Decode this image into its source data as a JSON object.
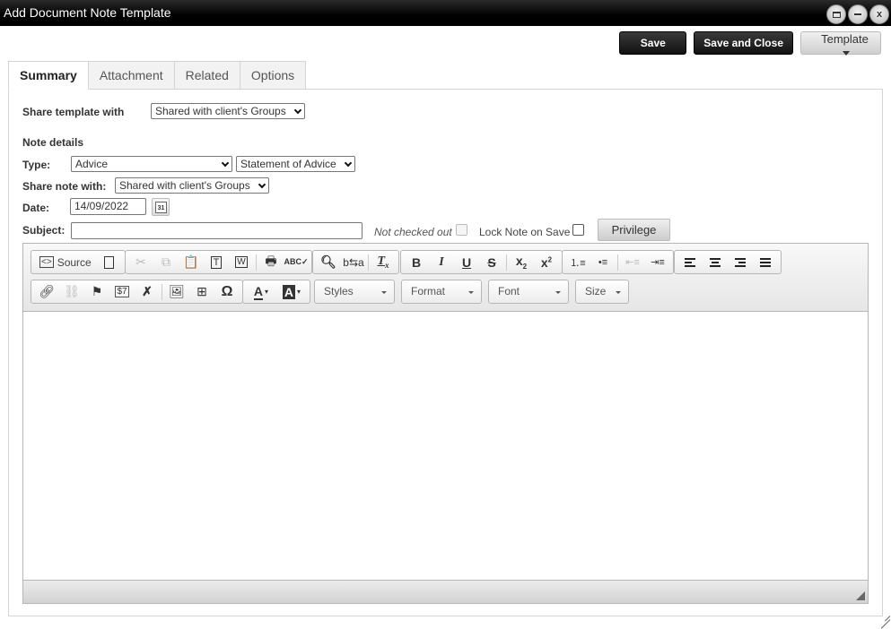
{
  "window": {
    "title": "Add Document Note Template",
    "controls": [
      "maximize",
      "minimize",
      "close"
    ],
    "close_label": "x"
  },
  "actions": {
    "save": "Save",
    "save_and_close": "Save and Close",
    "template": "Template"
  },
  "tabs": [
    {
      "label": "Summary",
      "active": true
    },
    {
      "label": "Attachment",
      "active": false
    },
    {
      "label": "Related",
      "active": false
    },
    {
      "label": "Options",
      "active": false
    }
  ],
  "form": {
    "share_template_label": "Share template with",
    "share_template_value": "Shared with client's Groups",
    "note_details_heading": "Note details",
    "type_label": "Type:",
    "type_value": "Advice",
    "subtype_value": "Statement of Advice",
    "share_note_label": "Share note with:",
    "share_note_value": "Shared with client's Groups",
    "date_label": "Date:",
    "date_value": "14/09/2022",
    "calendar_day": "31",
    "subject_label": "Subject:",
    "subject_value": "",
    "not_checked_out_label": "Not checked out",
    "not_checked_out_checked": false,
    "lock_note_label": "Lock Note on Save",
    "lock_note_checked": false,
    "privilege_button": "Privilege"
  },
  "editor": {
    "source_label": "Source",
    "combos": {
      "styles": "Styles",
      "format": "Format",
      "font": "Font",
      "size": "Size"
    },
    "content": ""
  }
}
